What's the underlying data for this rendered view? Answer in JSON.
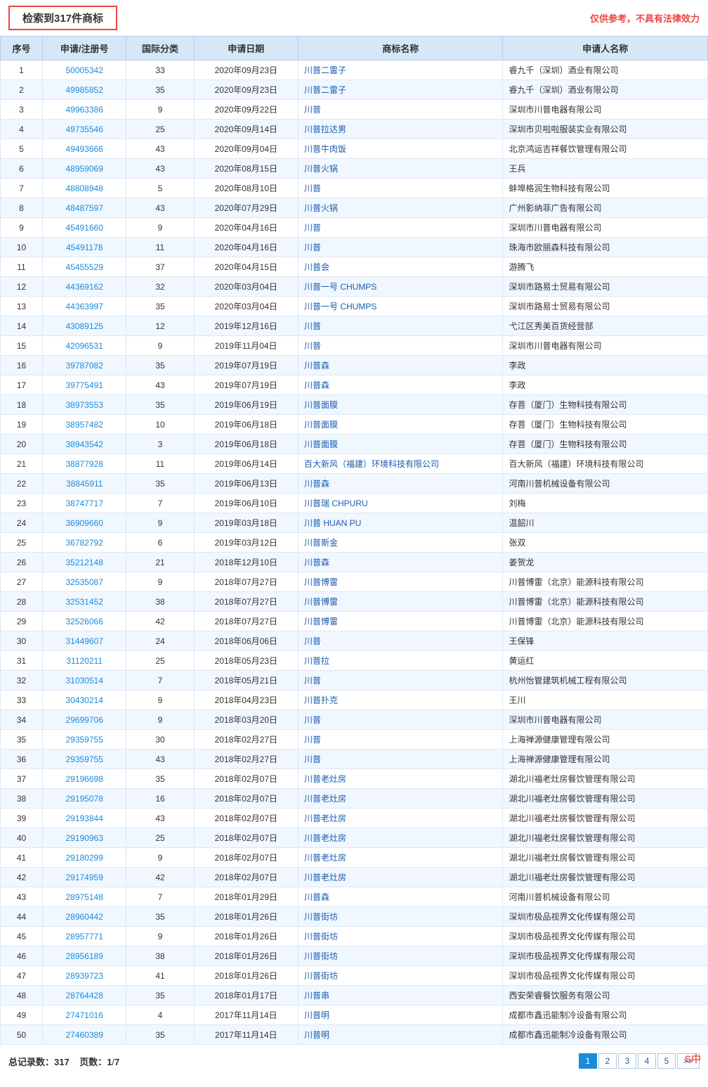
{
  "header": {
    "search_result": "检索到317件商标",
    "disclaimer": "仅供参考，不具有法律效力"
  },
  "table": {
    "columns": [
      "序号",
      "申请/注册号",
      "国际分类",
      "申请日期",
      "商标名称",
      "申请人名称"
    ],
    "rows": [
      [
        1,
        "50005342",
        33,
        "2020年09月23日",
        "川普二雷子",
        "睿九千（深圳）酒业有限公司"
      ],
      [
        2,
        "49985852",
        35,
        "2020年09月23日",
        "川普二雷子",
        "睿九千（深圳）酒业有限公司"
      ],
      [
        3,
        "49963386",
        9,
        "2020年09月22日",
        "川普",
        "深圳市川普电器有限公司"
      ],
      [
        4,
        "49735546",
        25,
        "2020年09月14日",
        "川普拉达男",
        "深圳市贝啦啦服装实业有限公司"
      ],
      [
        5,
        "49493666",
        43,
        "2020年09月04日",
        "川普牛肉饭",
        "北京鸿运吉祥餐饮管理有限公司"
      ],
      [
        6,
        "48959069",
        43,
        "2020年08月15日",
        "川普火锅",
        "王兵"
      ],
      [
        7,
        "48808948",
        5,
        "2020年08月10日",
        "川普",
        "蚌埠格润生物科技有限公司"
      ],
      [
        8,
        "48487597",
        43,
        "2020年07月29日",
        "川普火锅",
        "广州影纳菲广告有限公司"
      ],
      [
        9,
        "45491660",
        9,
        "2020年04月16日",
        "川普",
        "深圳市川普电器有限公司"
      ],
      [
        10,
        "45491178",
        11,
        "2020年04月16日",
        "川普",
        "珠海市欧丽森科技有限公司"
      ],
      [
        11,
        "45455529",
        37,
        "2020年04月15日",
        "川普会",
        "游腾飞"
      ],
      [
        12,
        "44369162",
        32,
        "2020年03月04日",
        "川普一号 CHUMPS",
        "深圳市路易士贸易有限公司"
      ],
      [
        13,
        "44363997",
        35,
        "2020年03月04日",
        "川普一号 CHUMPS",
        "深圳市路易士贸易有限公司"
      ],
      [
        14,
        "43089125",
        12,
        "2019年12月16日",
        "川普",
        "弋江区秀美百货经营部"
      ],
      [
        15,
        "42096531",
        9,
        "2019年11月04日",
        "川普",
        "深圳市川普电器有限公司"
      ],
      [
        16,
        "39787082",
        35,
        "2019年07月19日",
        "川普森",
        "李政"
      ],
      [
        17,
        "39775491",
        43,
        "2019年07月19日",
        "川普森",
        "李政"
      ],
      [
        18,
        "38973553",
        35,
        "2019年06月19日",
        "川普面膜",
        "存菩（厦门）生物科技有限公司"
      ],
      [
        19,
        "38957482",
        10,
        "2019年06月18日",
        "川普面膜",
        "存菩（厦门）生物科技有限公司"
      ],
      [
        20,
        "38943542",
        3,
        "2019年06月18日",
        "川普面膜",
        "存菩（厦门）生物科技有限公司"
      ],
      [
        21,
        "38877928",
        11,
        "2019年06月14日",
        "百大新风（福建）环境科技有限公司",
        "百大新风（福建）环境科技有限公司"
      ],
      [
        22,
        "38845911",
        35,
        "2019年06月13日",
        "川普森",
        "河南川普机械设备有限公司"
      ],
      [
        23,
        "38747717",
        7,
        "2019年06月10日",
        "川普瑞 CHPURU",
        "刘梅"
      ],
      [
        24,
        "36909660",
        9,
        "2019年03月18日",
        "川普 HUAN PU",
        "温韶川"
      ],
      [
        25,
        "36782792",
        6,
        "2019年03月12日",
        "川普斯金",
        "张双"
      ],
      [
        26,
        "35212148",
        21,
        "2018年12月10日",
        "川普森",
        "姜贺龙"
      ],
      [
        27,
        "32535087",
        9,
        "2018年07月27日",
        "川普博雷",
        "川普博雷（北京）能源科技有限公司"
      ],
      [
        28,
        "32531452",
        38,
        "2018年07月27日",
        "川普博雷",
        "川普博雷（北京）能源科技有限公司"
      ],
      [
        29,
        "32526066",
        42,
        "2018年07月27日",
        "川普博雷",
        "川普博雷（北京）能源科技有限公司"
      ],
      [
        30,
        "31449607",
        24,
        "2018年06月06日",
        "川普",
        "王保锋"
      ],
      [
        31,
        "31120211",
        25,
        "2018年05月23日",
        "川普拉",
        "黄运红"
      ],
      [
        32,
        "31030514",
        7,
        "2018年05月21日",
        "川普",
        "杭州怡管建筑机械工程有限公司"
      ],
      [
        33,
        "30430214",
        9,
        "2018年04月23日",
        "川普扑克",
        "王川"
      ],
      [
        34,
        "29699706",
        9,
        "2018年03月20日",
        "川普",
        "深圳市川普电器有限公司"
      ],
      [
        35,
        "29359755",
        30,
        "2018年02月27日",
        "川普",
        "上海禅源健康管理有限公司"
      ],
      [
        36,
        "29359755",
        43,
        "2018年02月27日",
        "川普",
        "上海禅源健康管理有限公司"
      ],
      [
        37,
        "29196698",
        35,
        "2018年02月07日",
        "川普老灶房",
        "湖北川福老灶房餐饮管理有限公司"
      ],
      [
        38,
        "29195078",
        16,
        "2018年02月07日",
        "川普老灶房",
        "湖北川福老灶房餐饮管理有限公司"
      ],
      [
        39,
        "29193844",
        43,
        "2018年02月07日",
        "川普老灶房",
        "湖北川福老灶房餐饮管理有限公司"
      ],
      [
        40,
        "29190963",
        25,
        "2018年02月07日",
        "川普老灶房",
        "湖北川福老灶房餐饮管理有限公司"
      ],
      [
        41,
        "29180299",
        9,
        "2018年02月07日",
        "川普老灶房",
        "湖北川福老灶房餐饮管理有限公司"
      ],
      [
        42,
        "29174959",
        42,
        "2018年02月07日",
        "川普老灶房",
        "湖北川福老灶房餐饮管理有限公司"
      ],
      [
        43,
        "28975148",
        7,
        "2018年01月29日",
        "川普森",
        "河南川普机械设备有限公司"
      ],
      [
        44,
        "28960442",
        35,
        "2018年01月26日",
        "川普街坊",
        "深圳市极品视界文化传媒有限公司"
      ],
      [
        45,
        "28957771",
        9,
        "2018年01月26日",
        "川普街坊",
        "深圳市极品视界文化传媒有限公司"
      ],
      [
        46,
        "28956189",
        38,
        "2018年01月26日",
        "川普街坊",
        "深圳市极品视界文化传媒有限公司"
      ],
      [
        47,
        "28939723",
        41,
        "2018年01月26日",
        "川普街坊",
        "深圳市极品视界文化传媒有限公司"
      ],
      [
        48,
        "28764428",
        35,
        "2018年01月17日",
        "川普串",
        "西安荣睿餐饮服务有限公司"
      ],
      [
        49,
        "27471016",
        4,
        "2017年11月14日",
        "川普明",
        "成都市鑫迅能制冷设备有限公司"
      ],
      [
        50,
        "27460389",
        35,
        "2017年11月14日",
        "川普明",
        "成都市鑫迅能制冷设备有限公司"
      ]
    ]
  },
  "footer": {
    "total_label": "总记录数：",
    "total_value": "317",
    "page_label": "页数：",
    "current_page": "1",
    "total_pages": "7",
    "pagination": [
      "1",
      "2",
      "3",
      "4",
      "5",
      ">>"
    ]
  },
  "watermark": "S中"
}
